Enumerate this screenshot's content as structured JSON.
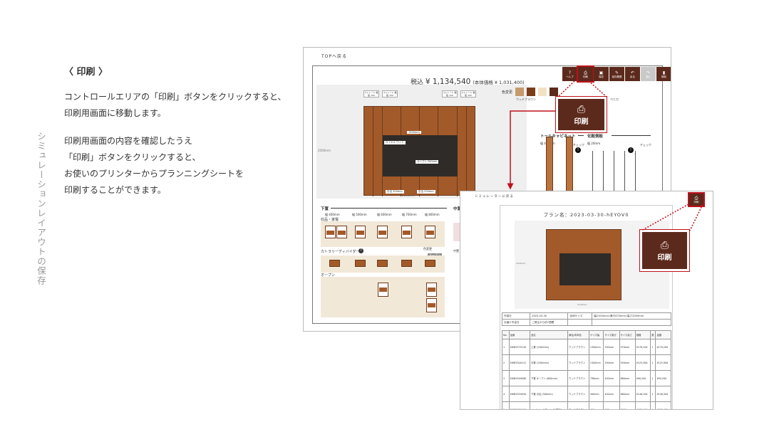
{
  "side_label": "シミュレーションレイアウトの保存",
  "section_title": "〈 印刷 〉",
  "para1": [
    "コントロールエリアの「印刷」ボタンをクリックすると、",
    "印刷用画面に移動します。"
  ],
  "para2": [
    "印刷用画面の内容を確認したうえ",
    "「印刷」ボタンをクリックすると、",
    "お使いのプリンターからプランニングシートを",
    "印刷することができます。"
  ],
  "simulator": {
    "top_link": "TOPへ戻る",
    "price_prefix": "税込",
    "price": "¥ 1,134,540",
    "price_tax": "(本体価格 ¥ 1,031,400)",
    "controls": [
      {
        "icon": "?",
        "label": "ヘルプ"
      },
      {
        "icon": "⎙",
        "label": "印刷"
      },
      {
        "icon": "▣",
        "label": "保存"
      },
      {
        "icon": "✎",
        "label": "保存履歴"
      },
      {
        "icon": "↶",
        "label": "戻る"
      },
      {
        "icon": "↷",
        "label": "進む"
      },
      {
        "icon": "▮",
        "label": "削除"
      }
    ],
    "height_dim": "2000mm",
    "width_dim": "2100mm",
    "cabinet_labels": [
      "1500mm",
      "ロイヤル ワイド",
      "オープン 300mm",
      "引出 300mm",
      "引出 200mm"
    ],
    "top_tags": [
      "ストレート 蝶板 150",
      "ストレート 蝶板 150",
      "ストレート 蝶板 150",
      "ストレート 蝶板 150"
    ],
    "color_label": "色変更",
    "color_names": [
      "ウッドブラウン",
      "ベージュ",
      "ペニカ"
    ],
    "right_cat": "トールキャビネット",
    "right_cat2": "化粧側板",
    "right_w1": "幅 480mm",
    "right_w2": "幅 20mm",
    "right_check": "チェック",
    "lower_title": "下置",
    "lower_widths": [
      "幅 400mm",
      "幅 500mm",
      "幅 600mm",
      "幅 700mm",
      "幅 800mm"
    ],
    "lower_sub": "収品・家電",
    "cutlery": "カトラリーディバイダー",
    "color_change": "色変更",
    "open_label": "オープン",
    "middle_title": "中置",
    "middle_sub": "中置",
    "open_badge": "オープン"
  },
  "zoom_label": "印刷",
  "preview": {
    "back_link": "シミュレーターに戻る",
    "print_label": "印刷",
    "plan_title": "プラン名：2023-03-30-hEYOV0",
    "height_dim": "2000mm",
    "width_dim": "2100mm",
    "info_rows": [
      [
        "作成日",
        "2023-03-30",
        "全体サイズ",
        "幅2100mm×奥行470mm×高さ2000mm"
      ],
      [
        "お届け予定日",
        "ご発注から約7週間",
        "",
        ""
      ]
    ],
    "item_headers": [
      "No.",
      "品番",
      "品名",
      "扉色/本体色",
      "サイズ幅",
      "サイズ奥行",
      "サイズ高さ",
      "価格",
      "数",
      "金額"
    ],
    "items": [
      [
        "1",
        "EWB537H130",
        "上置 (1300mm)",
        "ウッドブラウン",
        "1300mm",
        "350mm",
        "570mm",
        "¥178,200",
        "1",
        "¥178,200"
      ],
      [
        "2",
        "EWB530A131",
        "中置 (1300mm)",
        "ウッドブラウン",
        "1300mm",
        "350mm",
        "550mm",
        "¥125,900",
        "1",
        "¥125,900"
      ],
      [
        "3",
        "EWB534H080",
        "下置 オープン (800mm)",
        "ウッドブラウン",
        "798mm",
        "450mm",
        "880mm",
        "¥90,200",
        "1",
        "¥90,200"
      ],
      [
        "4",
        "EWB535H050",
        "下置 引出 (500mm)",
        "ウッドブラウン",
        "500mm",
        "450mm",
        "880mm",
        "¥146,300",
        "1",
        "¥146,300"
      ],
      [
        "5",
        "EWB537H045",
        "トールキャビネット (片開き)",
        "ウッドブラウン",
        "450mm",
        "450mm",
        "2000mm",
        "¥202,400",
        "1",
        "¥202,400"
      ]
    ]
  }
}
